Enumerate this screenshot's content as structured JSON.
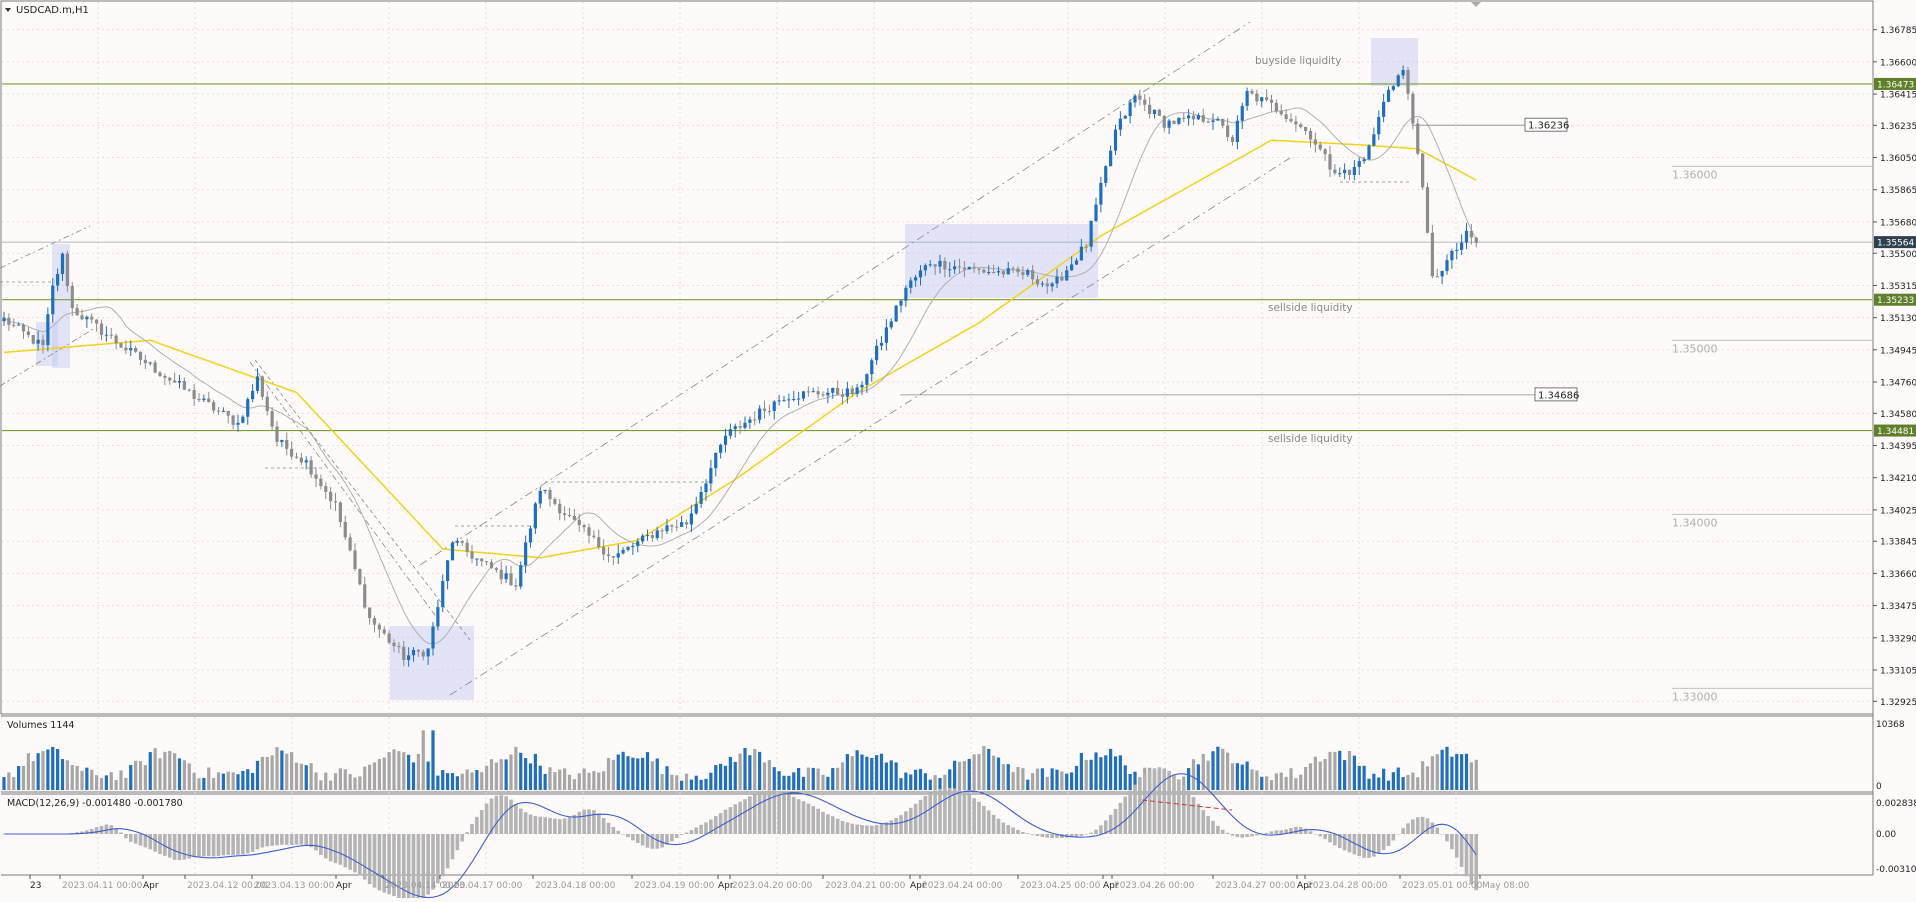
{
  "symbol_label": "USDCAD.m,H1",
  "price_axis": {
    "range": [
      1.32875,
      1.36875
    ],
    "ticks": [
      "1.36785",
      "1.36600",
      "1.36415",
      "1.36235",
      "1.36050",
      "1.35865",
      "1.35680",
      "1.35500",
      "1.35315",
      "1.35130",
      "1.34945",
      "1.34760",
      "1.34580",
      "1.34395",
      "1.34210",
      "1.34025",
      "1.33845",
      "1.33660",
      "1.33475",
      "1.33290",
      "1.33105",
      "1.32925"
    ]
  },
  "colors": {
    "bull": "#1f6fbf",
    "bear": "#8c8c8c",
    "sma_fast": "#b0b0b0",
    "sma_slow": "#f2d21a",
    "level_line": "#7a9a3a",
    "level_tag": "#5f7f2a",
    "current_tag": "#2f4050",
    "zone": "#bfc7f2",
    "volume_up": "#1f6fbf",
    "volume_down": "#a6a6a6",
    "macd_line": "#3c5fd0",
    "macd_hist": "#b4b4b4",
    "divergence": "#d03030"
  },
  "levels": [
    {
      "price": 1.36473,
      "tag": "1.36473"
    },
    {
      "price": 1.35233,
      "tag": "1.35233"
    },
    {
      "price": 1.34481,
      "tag": "1.34481"
    }
  ],
  "current_price": {
    "price": 1.35564,
    "tag": "1.35564"
  },
  "annotations": {
    "buyside": "buyside liquidity",
    "sellside_1": "sellside liquidity",
    "sellside_2": "sellside liquidity"
  },
  "price_callouts": [
    {
      "price": 1.36236,
      "label": "1.36236"
    },
    {
      "price": 1.34686,
      "label": "1.34686"
    }
  ],
  "round_levels": [
    {
      "price": 1.36,
      "label": "1.36000"
    },
    {
      "price": 1.35,
      "label": "1.35000"
    },
    {
      "price": 1.34,
      "label": "1.34000"
    },
    {
      "price": 1.33,
      "label": "1.33000"
    }
  ],
  "volumes_panel": {
    "label": "Volumes 1144",
    "max_label": "10368",
    "min_label": "0",
    "max_value": 10368
  },
  "macd_panel": {
    "label": "MACD(12,26,9) -0.001480 -0.001780",
    "ticks": [
      "0.002838",
      "0.00",
      "-0.003103"
    ],
    "range": [
      -0.003103,
      0.002838
    ]
  },
  "time_axis": {
    "labels": [
      "23",
      "2023.04.11 00:00",
      "Apr",
      "2023.04.12 00:00",
      "2023.04.13 00:00",
      "Apr",
      "2023.04.14 00:00",
      "2023.04.17 00:00",
      "2023.04.18 00:00",
      "2023.04.19 00:00",
      "Apr",
      "2023.04.20 00:00",
      "2023.04.21 00:00",
      "Apr",
      "2023.04.24 00:00",
      "2023.04.25 00:00",
      "Apr",
      "2023.04.26 00:00",
      "2023.04.27 00:00",
      "Apr",
      "2023.04.28 00:00",
      "2023.05.01 00:00",
      "May 08:00"
    ]
  },
  "chart_data": {
    "type": "candlestick",
    "timeframe": "H1",
    "price_anchors": [
      {
        "bar": 0,
        "price": 1.3512
      },
      {
        "bar": 8,
        "price": 1.3496
      },
      {
        "bar": 10,
        "price": 1.353
      },
      {
        "bar": 12,
        "price": 1.3548
      },
      {
        "bar": 14,
        "price": 1.3518
      },
      {
        "bar": 25,
        "price": 1.3495
      },
      {
        "bar": 40,
        "price": 1.3466
      },
      {
        "bar": 48,
        "price": 1.3452
      },
      {
        "bar": 52,
        "price": 1.3478
      },
      {
        "bar": 56,
        "price": 1.3442
      },
      {
        "bar": 62,
        "price": 1.343
      },
      {
        "bar": 68,
        "price": 1.3405
      },
      {
        "bar": 75,
        "price": 1.334
      },
      {
        "bar": 82,
        "price": 1.3318
      },
      {
        "bar": 87,
        "price": 1.3322
      },
      {
        "bar": 92,
        "price": 1.3385
      },
      {
        "bar": 98,
        "price": 1.3372
      },
      {
        "bar": 105,
        "price": 1.336
      },
      {
        "bar": 110,
        "price": 1.3415
      },
      {
        "bar": 118,
        "price": 1.3392
      },
      {
        "bar": 125,
        "price": 1.3375
      },
      {
        "bar": 135,
        "price": 1.3392
      },
      {
        "bar": 140,
        "price": 1.3395
      },
      {
        "bar": 148,
        "price": 1.3445
      },
      {
        "bar": 160,
        "price": 1.3468
      },
      {
        "bar": 168,
        "price": 1.347
      },
      {
        "bar": 175,
        "price": 1.347
      },
      {
        "bar": 185,
        "price": 1.353
      },
      {
        "bar": 190,
        "price": 1.3545
      },
      {
        "bar": 200,
        "price": 1.354
      },
      {
        "bar": 210,
        "price": 1.3538
      },
      {
        "bar": 215,
        "price": 1.353
      },
      {
        "bar": 222,
        "price": 1.3555
      },
      {
        "bar": 228,
        "price": 1.362
      },
      {
        "bar": 232,
        "price": 1.364
      },
      {
        "bar": 238,
        "price": 1.3625
      },
      {
        "bar": 248,
        "price": 1.3628
      },
      {
        "bar": 252,
        "price": 1.3615
      },
      {
        "bar": 255,
        "price": 1.3642
      },
      {
        "bar": 262,
        "price": 1.3632
      },
      {
        "bar": 268,
        "price": 1.3618
      },
      {
        "bar": 272,
        "price": 1.36
      },
      {
        "bar": 276,
        "price": 1.3595
      },
      {
        "bar": 280,
        "price": 1.361
      },
      {
        "bar": 284,
        "price": 1.3645
      },
      {
        "bar": 287,
        "price": 1.3655
      },
      {
        "bar": 290,
        "price": 1.361
      },
      {
        "bar": 293,
        "price": 1.3535
      },
      {
        "bar": 296,
        "price": 1.3545
      },
      {
        "bar": 300,
        "price": 1.356
      },
      {
        "bar": 302,
        "price": 1.3556
      }
    ],
    "sma_slow_anchors": [
      {
        "bar": 0,
        "price": 1.3493
      },
      {
        "bar": 30,
        "price": 1.35
      },
      {
        "bar": 60,
        "price": 1.347
      },
      {
        "bar": 90,
        "price": 1.338
      },
      {
        "bar": 110,
        "price": 1.3375
      },
      {
        "bar": 130,
        "price": 1.3385
      },
      {
        "bar": 150,
        "price": 1.342
      },
      {
        "bar": 175,
        "price": 1.347
      },
      {
        "bar": 200,
        "price": 1.351
      },
      {
        "bar": 225,
        "price": 1.356
      },
      {
        "bar": 260,
        "price": 1.3615
      },
      {
        "bar": 280,
        "price": 1.3612
      },
      {
        "bar": 290,
        "price": 1.361
      },
      {
        "bar": 302,
        "price": 1.3592
      }
    ]
  }
}
